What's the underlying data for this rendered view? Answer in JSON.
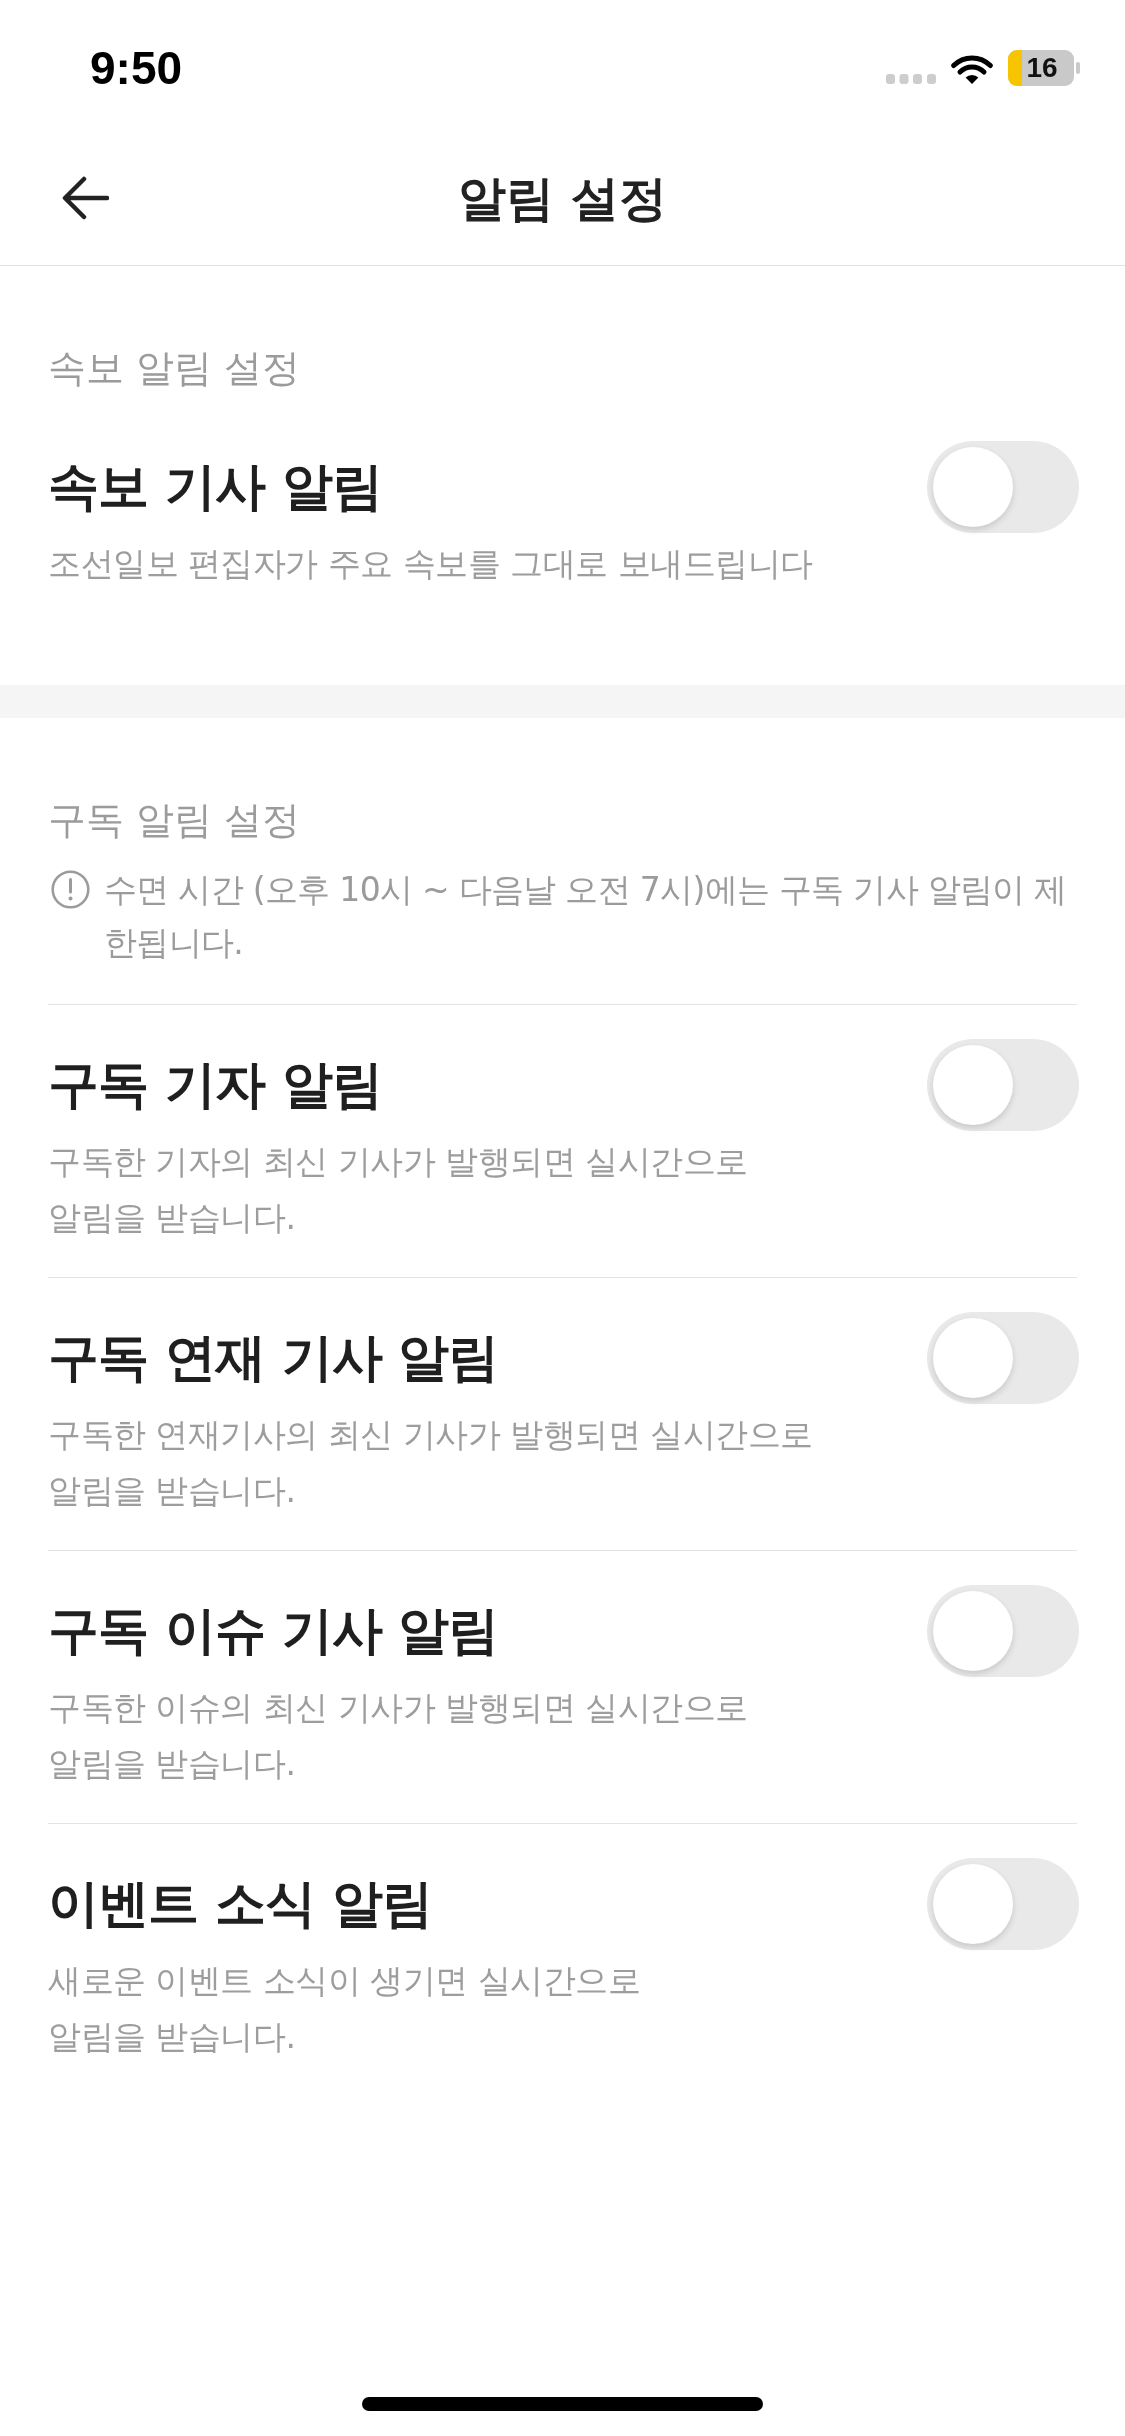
{
  "status_bar": {
    "time": "9:50",
    "battery": "16"
  },
  "header": {
    "title": "알림 설정"
  },
  "sections": [
    {
      "title": "속보 알림 설정",
      "items": [
        {
          "title": "속보 기사 알림",
          "description": "조선일보 편집자가 주요 속보를 그대로 보내드립니다",
          "on": false
        }
      ]
    },
    {
      "title": "구독 알림 설정",
      "notice": "수면 시간 (오후 10시 ~ 다음날 오전 7시)에는 구독 기사 알림이 제한됩니다.",
      "items": [
        {
          "title": "구독 기자 알림",
          "description": "구독한 기자의 최신 기사가 발행되면 실시간으로\n알림을 받습니다.",
          "on": false
        },
        {
          "title": "구독 연재 기사 알림",
          "description": "구독한 연재기사의 최신 기사가 발행되면 실시간으로\n알림을 받습니다.",
          "on": false
        },
        {
          "title": "구독 이슈 기사 알림",
          "description": "구독한 이슈의 최신 기사가 발행되면 실시간으로\n알림을 받습니다.",
          "on": false
        },
        {
          "title": "이벤트 소식 알림",
          "description": "새로운 이벤트 소식이 생기면 실시간으로\n알림을 받습니다.",
          "on": false
        }
      ]
    }
  ]
}
